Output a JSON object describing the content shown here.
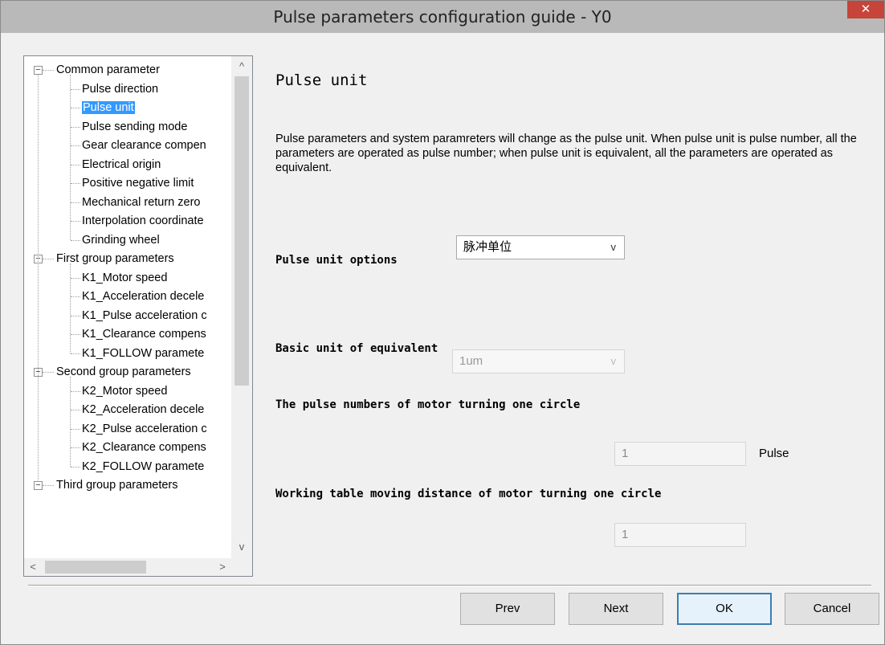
{
  "window": {
    "title": "Pulse parameters configuration guide - Y0",
    "close_label": "✕"
  },
  "tree": {
    "groups": [
      {
        "label": "Common parameter",
        "expander": "−",
        "children": [
          "Pulse direction",
          "Pulse unit",
          "Pulse sending mode",
          "Gear clearance compen",
          "Electrical origin",
          "Positive negative limit",
          "Mechanical return zero",
          "Interpolation coordinate",
          "Grinding wheel"
        ]
      },
      {
        "label": "First group parameters",
        "expander": "−",
        "children": [
          "K1_Motor speed",
          "K1_Acceleration decele",
          "K1_Pulse acceleration c",
          "K1_Clearance compens",
          "K1_FOLLOW paramete"
        ]
      },
      {
        "label": "Second group parameters",
        "expander": "−",
        "children": [
          "K2_Motor speed",
          "K2_Acceleration decele",
          "K2_Pulse acceleration c",
          "K2_Clearance compens",
          "K2_FOLLOW paramete"
        ]
      },
      {
        "label": "Third group parameters",
        "expander": "−",
        "children": []
      }
    ],
    "selected": "Pulse unit",
    "scroll_up": "^",
    "scroll_down": "v",
    "scroll_left": "<",
    "scroll_right": ">"
  },
  "main": {
    "heading": "Pulse unit",
    "description": "Pulse parameters and system paramreters will change as the pulse unit. When pulse unit is pulse number, all the parameters are operated as pulse number; when pulse unit is equivalent, all the parameters are operated as equivalent.",
    "pulse_unit_options": {
      "label": "Pulse unit options",
      "value": "脉冲单位",
      "chevron": "v"
    },
    "basic_unit": {
      "label": "Basic unit of equivalent",
      "value": "1um",
      "chevron": "v"
    },
    "pulse_numbers": {
      "label": "The pulse numbers of motor turning one circle",
      "value": "1",
      "unit": "Pulse"
    },
    "moving_distance": {
      "label": "Working table moving distance of motor turning one circle",
      "value": "1"
    }
  },
  "buttons": {
    "prev": "Prev",
    "next": "Next",
    "ok": "OK",
    "cancel": "Cancel"
  }
}
